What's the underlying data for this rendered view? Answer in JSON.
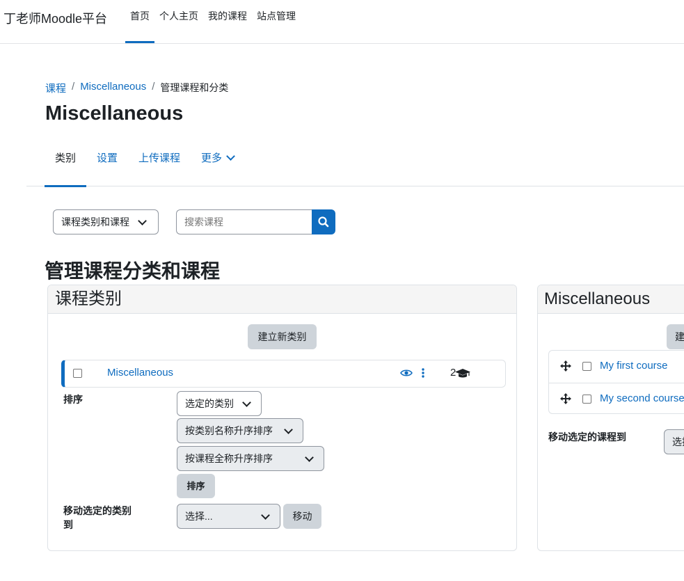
{
  "brand": "丁老师Moodle平台",
  "topnav": [
    "首页",
    "个人主页",
    "我的课程",
    "站点管理"
  ],
  "breadcrumb": {
    "item1": "课程",
    "item2": "Miscellaneous",
    "current": "管理课程和分类"
  },
  "page_title": "Miscellaneous",
  "tabs": {
    "category": "类别",
    "settings": "设置",
    "upload": "上传课程",
    "more": "更多"
  },
  "view_select": "课程类别和课程",
  "search": {
    "placeholder": "搜索课程"
  },
  "main_heading": "管理课程分类和课程",
  "categories_panel": {
    "title": "课程类别",
    "create_button": "建立新类别",
    "category_name": "Miscellaneous",
    "course_count": "2",
    "sort_label": "排序",
    "sort_selects": [
      "选定的类别",
      "按类别名称升序排序",
      "按课程全称升序排序"
    ],
    "sort_button": "排序",
    "move_label": "移动选定的类别到",
    "move_select": "选择...",
    "move_button": "移动"
  },
  "courses_panel": {
    "title": "Miscellaneous",
    "create_button": "建",
    "courses": [
      "My first course",
      "My second course"
    ],
    "move_label": "移动选定的课程到",
    "move_select": "选择"
  }
}
